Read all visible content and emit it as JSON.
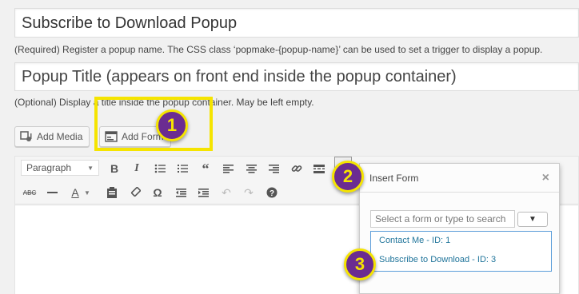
{
  "fields": {
    "popup_name": "Subscribe to Download Popup",
    "popup_name_desc": "(Required) Register a popup name. The CSS class ‘popmake-{popup-name}’ can be used to set a trigger to display a popup.",
    "popup_title_placeholder": "Popup Title (appears on front end inside the popup container)",
    "popup_title_desc": "(Optional) Display a title inside the popup container. May be left empty."
  },
  "media_buttons": {
    "add_media": "Add Media",
    "add_form": "Add Form"
  },
  "toolbar": {
    "format_select": "Paragraph",
    "icons_row1": [
      "bold-icon",
      "italic-icon",
      "bullet-list-icon",
      "numbered-list-icon",
      "blockquote-icon",
      "align-left-icon",
      "align-center-icon",
      "align-right-icon",
      "link-icon",
      "read-more-icon",
      "toolbar-toggle-icon"
    ],
    "icons_row2": [
      "strikethrough-icon",
      "horizontal-line-icon",
      "text-color-icon",
      "paste-text-icon",
      "clear-formatting-icon",
      "special-character-icon",
      "outdent-icon",
      "indent-icon",
      "undo-icon",
      "redo-icon",
      "help-icon"
    ]
  },
  "callouts": [
    "1",
    "2",
    "3"
  ],
  "insert_form_dialog": {
    "title": "Insert Form",
    "close": "×",
    "search_placeholder": "Select a form or type to search",
    "select_caret": "▼",
    "options": [
      "Contact Me - ID: 1",
      "Subscribe to Download - ID: 3"
    ]
  },
  "colors": {
    "callout_fill": "#6b2c91",
    "callout_outline": "#f5e400",
    "link_blue": "#21759b"
  }
}
